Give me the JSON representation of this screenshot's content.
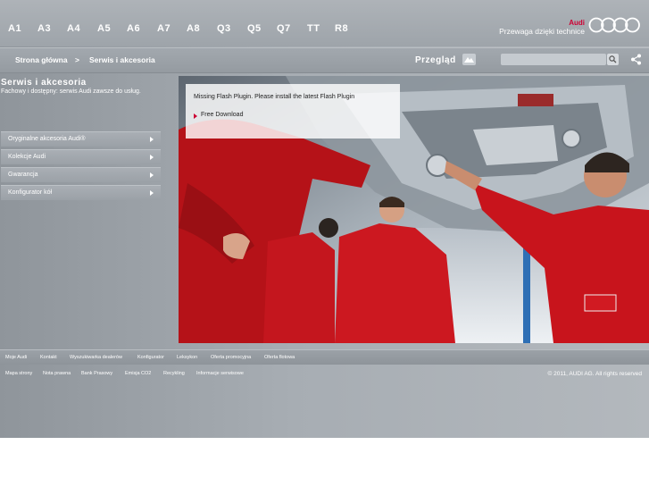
{
  "models": [
    "A1",
    "A3",
    "A4",
    "A5",
    "A6",
    "A7",
    "A8",
    "Q3",
    "Q5",
    "Q7",
    "TT",
    "R8"
  ],
  "brand": {
    "name": "Audi",
    "slogan": "Przewaga dzięki technice",
    "logo_icon": "audi-rings-icon"
  },
  "nav": {
    "breadcrumb": [
      "Strona główna",
      "Serwis i akcesoria"
    ],
    "separator": ">",
    "overview_label": "Przegląd",
    "search_placeholder": "",
    "icons": [
      "search-icon",
      "share-icon",
      "overview-icon"
    ]
  },
  "section": {
    "title": "Serwis i akcesoria",
    "description": "Fachowy i dostępny: serwis Audi zawsze do usług."
  },
  "side_menu": [
    "Oryginalne akcesoria Audi®",
    "Kolekcje Audi",
    "Gwarancja",
    "Konfigurator kół"
  ],
  "flash": {
    "message": "Missing Flash Plugin. Please install the latest Flash Plugin",
    "link": "Free Download"
  },
  "footer": {
    "links_row1": [
      "Moje Audi",
      "Kontakt",
      "Wyszukiwarka dealerów",
      "Konfigurator",
      "Leksykon",
      "Oferta promocyjna",
      "Oferta flotowa"
    ],
    "links_row2": [
      "Mapa strony",
      "Nota prawna",
      "Bank Prasowy",
      "Emisja CO2",
      "Recykling",
      "Informacje serwisowe"
    ],
    "copyright": "© 2011, AUDI AG. All rights reserved"
  },
  "colors": {
    "accent": "#cc0033",
    "background": "#a4aab0",
    "uniform": "#c8141c"
  }
}
